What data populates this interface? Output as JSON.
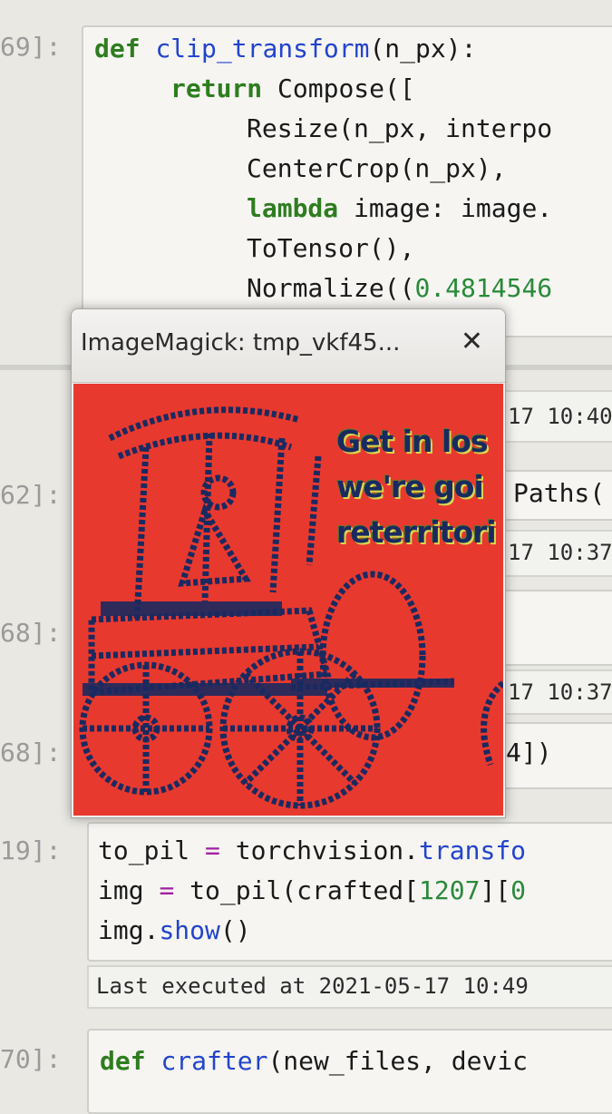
{
  "notebook": {
    "cell1": {
      "prompt": "69]:",
      "lines": [
        {
          "k1": "def",
          "f1": "clip_transform",
          "r1": "(n_px):"
        },
        {
          "k1": "return",
          "t1": " Compose(["
        },
        {
          "t1": "Resize(n_px, interpo"
        },
        {
          "t1": "CenterCrop(n_px),"
        },
        {
          "k1": "lambda",
          "t1": " image: image."
        },
        {
          "t1": "ToTensor(),"
        },
        {
          "t1": "Normalize((",
          "n1": "0.4814546"
        }
      ]
    },
    "hidden_outputs": [
      {
        "prompt": "",
        "meta": "17 10:40"
      },
      {
        "prompt": "62]:",
        "code": "Paths("
      },
      {
        "prompt": "",
        "meta": "17 10:37"
      },
      {
        "prompt": "68]:",
        "code": ""
      },
      {
        "prompt": "",
        "meta": "17 10:37"
      },
      {
        "prompt": "68]:",
        "code": "4])"
      }
    ],
    "cell2": {
      "prompt": "19]:",
      "line1": {
        "a": "to_pil ",
        "op": "=",
        "b": " torchvision.",
        "c": "transfo"
      },
      "line2": {
        "a": "img ",
        "op": "=",
        "b": " to_pil(crafted[",
        "n": "1207",
        "c": "][",
        "n2": "0"
      },
      "line3": {
        "a": "img.",
        "c": "show",
        "b": "()"
      }
    },
    "last_executed": "Last executed at 2021-05-17 10:49",
    "cell3": {
      "prompt": "70]:",
      "kw": "def",
      "fn": "crafter",
      "rest": "(new_files, devic"
    }
  },
  "imagemagick": {
    "title": "ImageMagick: tmp_vkf45...",
    "close_label": "✕",
    "caption_lines": [
      "Get in los",
      "we're goi",
      "reterritori"
    ],
    "colors": {
      "background": "#e8392f",
      "ink": "#1a2a60",
      "highlight": "#d8d84a"
    }
  }
}
